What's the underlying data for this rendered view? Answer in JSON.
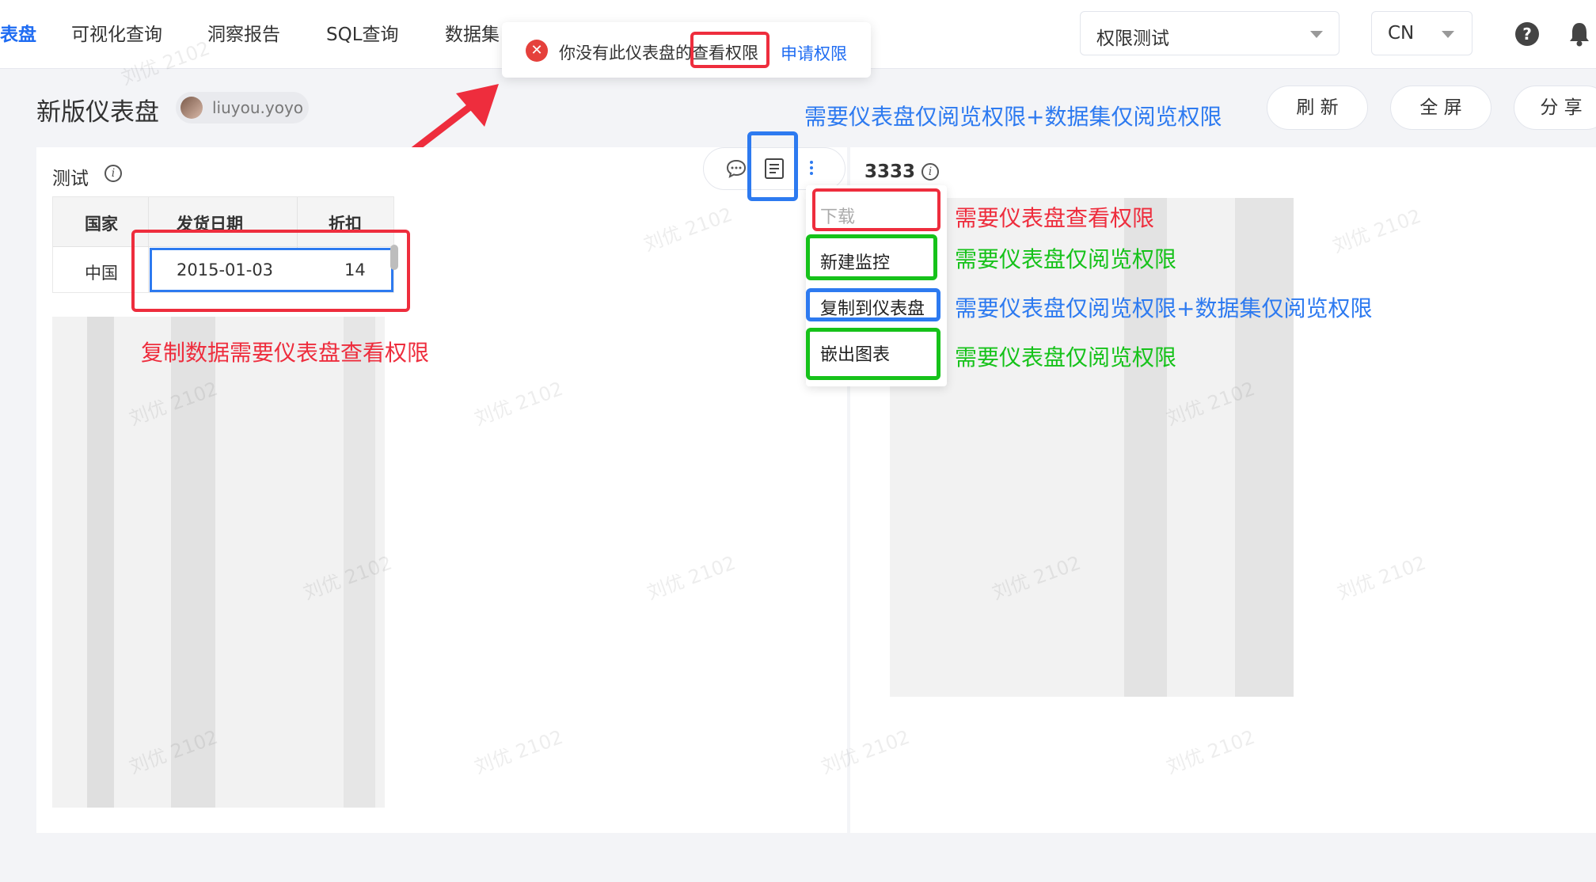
{
  "nav": {
    "active": "表盘",
    "items": [
      "可视化查询",
      "洞察报告",
      "SQL查询",
      "数据集"
    ]
  },
  "space_select": {
    "value": "权限测试"
  },
  "lang_select": {
    "value": "CN"
  },
  "help": {
    "glyph": "?"
  },
  "toast": {
    "error_glyph": "✕",
    "message_prefix": "你没有此仪表盘的",
    "message_highlight": "查看权限",
    "apply_link": "申请权限"
  },
  "dashboard": {
    "title": "新版仪表盘",
    "owner": "liuyou.yoyo",
    "buttons": {
      "refresh": "刷 新",
      "fullscreen": "全 屏",
      "share": "分 享"
    }
  },
  "card_left": {
    "title": "测试",
    "info_glyph": "i",
    "table": {
      "headers": [
        "国家",
        "发货日期",
        "折扣"
      ],
      "row": [
        "中国",
        "2015-01-03",
        "14"
      ]
    }
  },
  "card_right": {
    "title": "3333",
    "info_glyph": "i"
  },
  "menu": {
    "items": [
      "下载",
      "新建监控",
      "复制到仪表盘",
      "嵌出图表"
    ]
  },
  "annotations": {
    "copy_data": "复制数据需要仪表盘查看权限",
    "toolbar_copy": "需要仪表盘仅阅览权限+数据集仅阅览权限",
    "download": "需要仪表盘查看权限",
    "new_monitor": "需要仪表盘仅阅览权限",
    "copy_to_dashboard": "需要仪表盘仅阅览权限+数据集仅阅览权限",
    "embed_chart": "需要仪表盘仅阅览权限"
  },
  "watermark_text": "刘优 2102",
  "colors": {
    "accent": "#1f6cf2",
    "annotation_red": "#ee2d3d",
    "annotation_green": "#16c21a",
    "annotation_blue": "#2d7af0"
  }
}
